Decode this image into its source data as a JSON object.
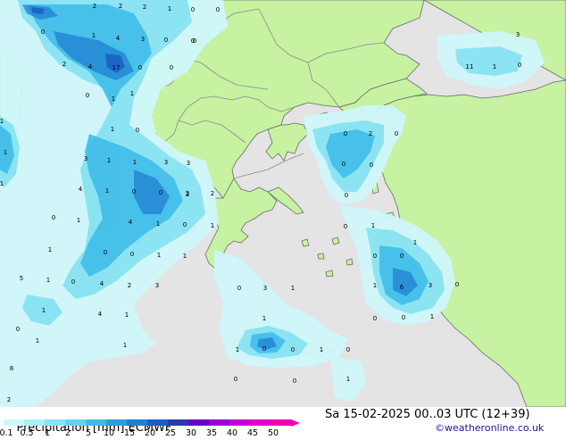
{
  "title": "Precipitation [mm]",
  "model": "ECMWF",
  "valid_time": "Sa 15-02-2025 00..03 UTC (12+39)",
  "credit": "©weatheronline.co.uk",
  "colors": {
    "sea": "#e4e4e4",
    "land": "#c6f2a2",
    "border": "#8a8a8a",
    "coast": "#6a6a6a"
  },
  "legend": {
    "labels": [
      "0.1",
      "0.5",
      "1",
      "2",
      "5",
      "10",
      "15",
      "20",
      "25",
      "30",
      "35",
      "40",
      "45",
      "50"
    ],
    "colors": [
      "#cff7fb",
      "#aaeef6",
      "#88e3f2",
      "#62d4ef",
      "#3fbde8",
      "#2a9edc",
      "#1f7fd2",
      "#1a5dc4",
      "#2a3aa8",
      "#6a00c8",
      "#9a00d8",
      "#c400d8",
      "#e000c8",
      "#f000b0"
    ]
  },
  "map_values": [
    "2",
    "2",
    "2",
    "1",
    "0",
    "0",
    "0",
    "1",
    "4",
    "3",
    "0",
    "0",
    "2",
    "4",
    "17",
    "0",
    "0",
    "1",
    "1",
    "1",
    "0",
    "3",
    "1",
    "1",
    "3",
    "3",
    "1",
    "0",
    "0",
    "4",
    "2",
    "2",
    "0",
    "1",
    "4",
    "1",
    "0",
    "1",
    "1",
    "0",
    "0",
    "1",
    "1",
    "5",
    "1",
    "0",
    "4",
    "2",
    "3",
    "0",
    "3",
    "1",
    "1",
    "4",
    "1",
    "0",
    "1",
    "1",
    "8",
    "2",
    "0",
    "2",
    "0",
    "0",
    "0",
    "0",
    "0",
    "1",
    "0",
    "1",
    "0",
    "1",
    "6",
    "3",
    "0",
    "0",
    "0",
    "1",
    "1",
    "1",
    "0",
    "0",
    "1",
    "0",
    "0",
    "0",
    "1",
    "0",
    "0",
    "1",
    "1",
    "1",
    "11",
    "1",
    "0",
    "3",
    "3",
    "1",
    "0"
  ]
}
